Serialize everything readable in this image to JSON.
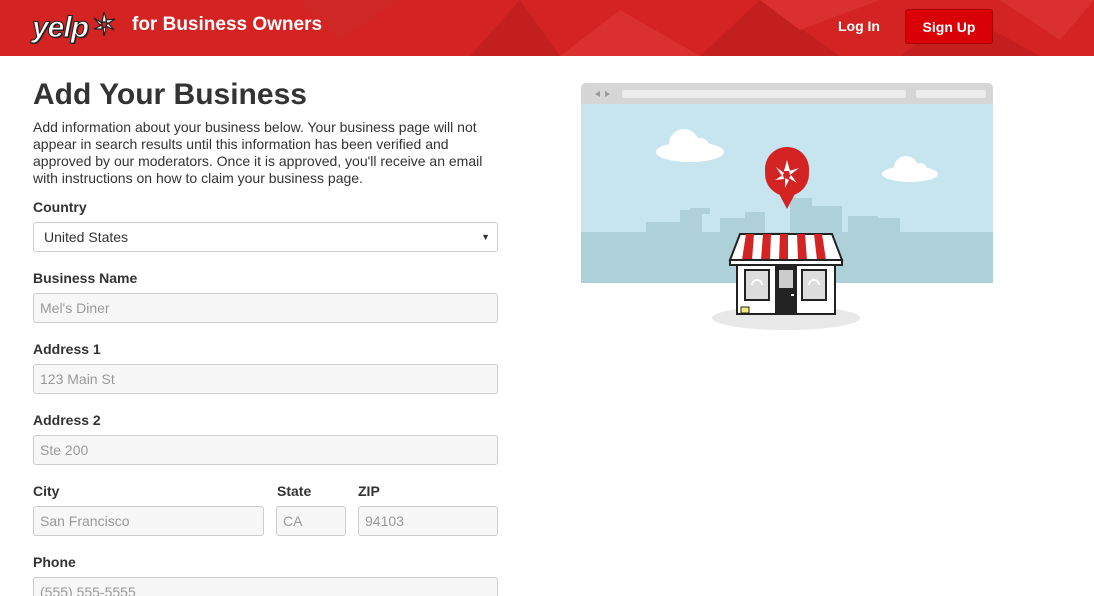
{
  "header": {
    "logo_text": "yelp",
    "tagline": "for Business Owners",
    "login_label": "Log In",
    "signup_label": "Sign Up"
  },
  "form": {
    "title": "Add Your Business",
    "intro": "Add information about your business below. Your business page will not appear in search results until this information has been verified and approved by our moderators. Once it is approved, you'll receive an email with instructions on how to claim your business page.",
    "country": {
      "label": "Country",
      "selected": "United States"
    },
    "business_name": {
      "label": "Business Name",
      "placeholder": "Mel's Diner"
    },
    "address1": {
      "label": "Address 1",
      "placeholder": "123 Main St"
    },
    "address2": {
      "label": "Address 2",
      "placeholder": "Ste 200"
    },
    "city": {
      "label": "City",
      "placeholder": "San Francisco"
    },
    "state": {
      "label": "State",
      "placeholder": "CA"
    },
    "zip": {
      "label": "ZIP",
      "placeholder": "94103"
    },
    "phone": {
      "label": "Phone",
      "placeholder": "(555) 555-5555"
    }
  },
  "colors": {
    "brand_red": "#d32323",
    "signup_red": "#d90007",
    "sky": "#c6e5ef",
    "skyline": "#aed0d9"
  }
}
